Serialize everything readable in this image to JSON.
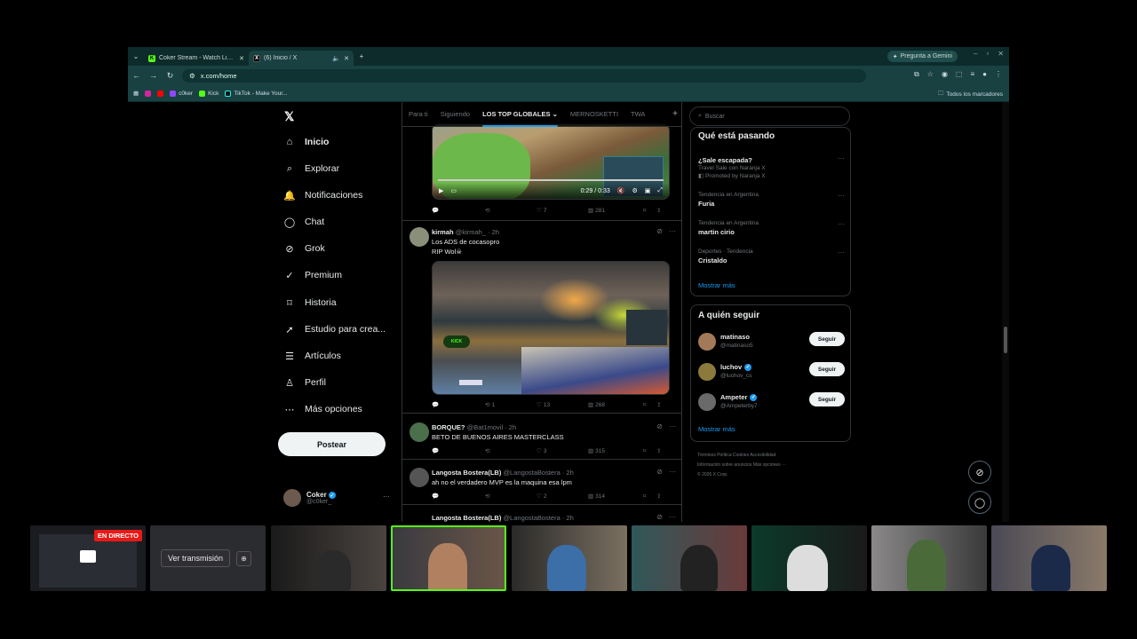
{
  "browser": {
    "tabs": [
      {
        "title": "Coker Stream - Watch Live on Kick",
        "favicon": "kick"
      },
      {
        "title": "(6) Inicio / X",
        "favicon": "x"
      }
    ],
    "gemini_label": "Pregunta a Gemini",
    "url": "x.com/home",
    "bookmarks": [
      "c0ker",
      "Kick",
      "TikTok - Make Your..."
    ],
    "all_bookmarks": "Todos los marcadores"
  },
  "nav": {
    "items": [
      {
        "label": "Inicio",
        "icon": "home-icon"
      },
      {
        "label": "Explorar",
        "icon": "search-icon"
      },
      {
        "label": "Notificaciones",
        "icon": "bell-icon"
      },
      {
        "label": "Chat",
        "icon": "chat-icon"
      },
      {
        "label": "Grok",
        "icon": "grok-icon"
      },
      {
        "label": "Premium",
        "icon": "premium-icon"
      },
      {
        "label": "Historia",
        "icon": "bookmark-icon"
      },
      {
        "label": "Estudio para crea...",
        "icon": "rocket-icon"
      },
      {
        "label": "Artículos",
        "icon": "article-icon"
      },
      {
        "label": "Perfil",
        "icon": "person-icon"
      },
      {
        "label": "Más opciones",
        "icon": "more-icon"
      }
    ],
    "post_label": "Postear",
    "me": {
      "name": "Coker",
      "handle": "@c0ker_"
    }
  },
  "feed": {
    "tabs": [
      "Para ti",
      "Siguiendo",
      "LOS TOP GLOBALES",
      "MERNOSKETTI",
      "TWA"
    ],
    "video1": {
      "time": "0:29 / 0:33",
      "likes": "7",
      "views": "281"
    },
    "tweets": [
      {
        "name": "kirmah",
        "handle": "@kirmah_ · 2h",
        "lines": [
          "Los ADS de cocasopro",
          "RIP Wol☠"
        ],
        "retweets": "1",
        "likes": "13",
        "views": "268"
      },
      {
        "name": "BORQUE?",
        "handle": "@Bat1movil · 2h",
        "lines": [
          "BETO DE BUENOS AIRES MASTERCLASS"
        ],
        "likes": "3",
        "views": "315"
      },
      {
        "name": "Langosta Bostera(LB)",
        "handle": "@LangostaBostera · 2h",
        "lines": [
          "ah no el verdadero MVP es la maquina esa lpm"
        ],
        "likes": "2",
        "views": "314"
      },
      {
        "name": "Langosta Bostera(LB)",
        "handle": "@LangostaBostera · 2h",
        "lines": [
          ""
        ]
      }
    ]
  },
  "sidebar": {
    "search_placeholder": "Buscar",
    "trends_title": "Qué está pasando",
    "trends": [
      {
        "context": "",
        "name": "¿Sale escapada?",
        "sub": "Travel Sale con Naranja X",
        "promo": "Promoted by Naranja X"
      },
      {
        "context": "Tendencia en Argentina",
        "name": "Furia",
        "sub": ""
      },
      {
        "context": "Tendencia en Argentina",
        "name": "martin cirio",
        "sub": ""
      },
      {
        "context": "Deportes · Tendencia",
        "name": "Cristaldo",
        "sub": ""
      }
    ],
    "show_more": "Mostrar más",
    "follow_title": "A quién seguir",
    "follow": [
      {
        "name": "matinaso",
        "handle": "@matinaso5",
        "verified": false
      },
      {
        "name": "luchov",
        "handle": "@luchov_cs",
        "verified": true
      },
      {
        "name": "Ampeter",
        "handle": "@Ampeterby7",
        "verified": true
      }
    ],
    "follow_button": "Seguir",
    "footer1": "Términos   Política   Cookies   Accesibilidad",
    "footer2": "Información sobre anuncios   Más opciones ···",
    "footer3": "© 2026 X Corp."
  },
  "strip": {
    "live_label": "EN DIRECTO",
    "watch_label": "Ver transmisión"
  }
}
